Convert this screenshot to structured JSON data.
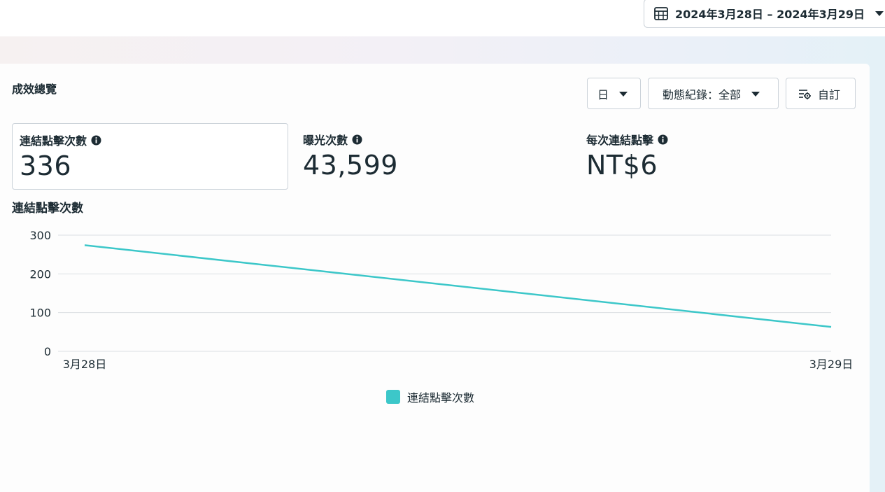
{
  "header": {
    "date_range": "2024年3月28日 – 2024年3月29日"
  },
  "card": {
    "title": "成效總覽",
    "buttons": {
      "granularity": "日",
      "activity": "動態紀錄：全部",
      "customize": "自訂"
    }
  },
  "metrics": [
    {
      "label": "連結點擊次數",
      "value": "336",
      "selected": true
    },
    {
      "label": "曝光次數",
      "value": "43,599",
      "selected": false
    },
    {
      "label": "每次連結點擊",
      "value": "NT$6",
      "selected": false
    }
  ],
  "chart_data": {
    "type": "line",
    "title": "連結點擊次數",
    "x": [
      "3月28日",
      "3月29日"
    ],
    "series": [
      {
        "name": "連結點擊次數",
        "values": [
          274,
          63
        ],
        "color": "#3cc7c9"
      }
    ],
    "yticks": [
      0,
      100,
      200,
      300
    ],
    "ylim": [
      0,
      300
    ],
    "grid": true,
    "legend": "bottom-center"
  },
  "colors": {
    "accent": "#3cc7c9",
    "text": "#1c2b33",
    "border": "#cbd2d9"
  },
  "icons": {
    "date_picker": "calendar-icon",
    "caret": "caret-down-icon",
    "customize": "settings-sliders-icon",
    "info": "info-icon"
  }
}
